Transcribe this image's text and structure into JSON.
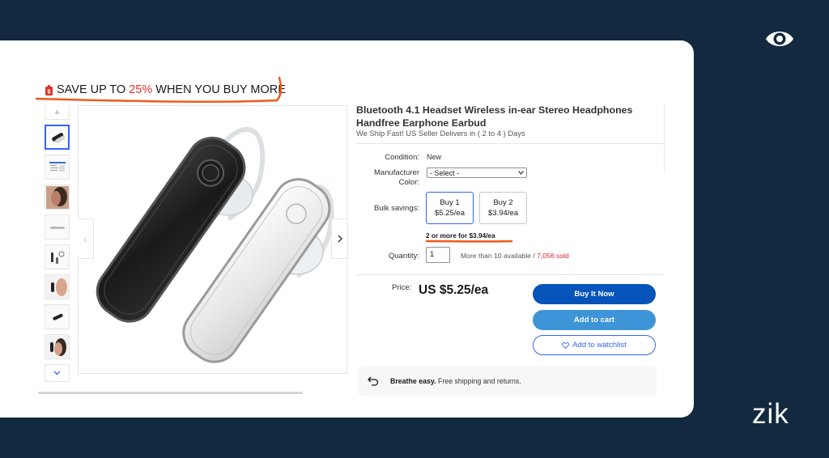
{
  "overlay": {
    "brand": "zik",
    "eye_icon": "eye-icon"
  },
  "promo": {
    "prefix": "SAVE UP TO ",
    "percent": "25%",
    "suffix": " WHEN YOU BUY MORE",
    "icon": "tag-icon"
  },
  "gallery": {
    "thumbnails": [
      "black-headset",
      "product-chart",
      "worn-headset",
      "white-headset",
      "accessories",
      "headset-model",
      "black-earpiece",
      "headset-model-2"
    ],
    "selected_index": 0
  },
  "product": {
    "title": "Bluetooth 4.1 Headset Wireless in-ear Stereo Headphones Handfree Earphone Earbud",
    "subtitle": "We Ship Fast! US Seller Delivers in ( 2 to 4 ) Days"
  },
  "specs": {
    "condition_label": "Condition:",
    "condition_value": "New",
    "color_label_1": "Manufacturer",
    "color_label_2": "Color:",
    "color_select": "- Select -"
  },
  "bulk": {
    "label": "Bulk savings:",
    "options": [
      {
        "title": "Buy 1",
        "price": "$5.25/ea"
      },
      {
        "title": "Buy 2",
        "price": "$3.94/ea"
      }
    ],
    "note": "2 or more for $3.94/ea"
  },
  "quantity": {
    "label": "Quantity:",
    "value": "1",
    "available": "More than 10 available / ",
    "sold": "7,056 sold"
  },
  "price": {
    "label": "Price:",
    "value": "US $5.25/ea"
  },
  "buttons": {
    "buy": "Buy It Now",
    "cart": "Add to cart",
    "watch": "Add to watchlist"
  },
  "shipping": {
    "bold": "Breathe easy.",
    "text": " Free shipping and returns."
  },
  "colors": {
    "accent": "#3665f3",
    "buy": "#0654ba",
    "cart": "#3d95d8",
    "annotation": "#ef5a1e",
    "background": "#13293f"
  }
}
